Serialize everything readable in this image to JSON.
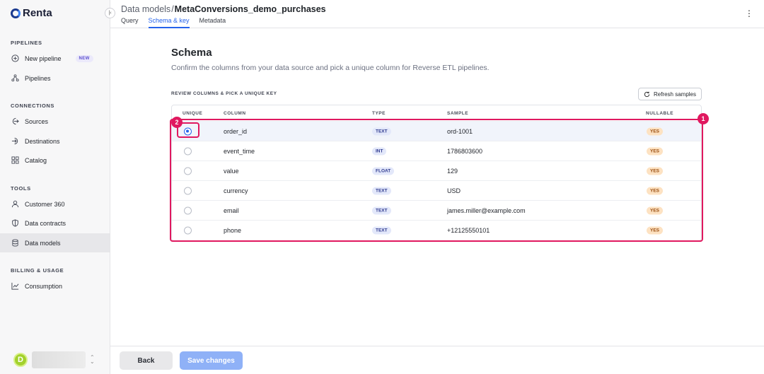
{
  "app": {
    "name": "Renta"
  },
  "sidebar": {
    "sections": [
      {
        "title": "PIPELINES"
      },
      {
        "title": "CONNECTIONS"
      },
      {
        "title": "TOOLS"
      },
      {
        "title": "BILLING & USAGE"
      }
    ],
    "items": [
      {
        "label": "New pipeline",
        "icon": "plus-circle-icon",
        "badge": "NEW"
      },
      {
        "label": "Pipelines",
        "icon": "nodes-icon"
      },
      {
        "label": "Sources",
        "icon": "source-icon"
      },
      {
        "label": "Destinations",
        "icon": "destination-icon"
      },
      {
        "label": "Catalog",
        "icon": "grid-icon"
      },
      {
        "label": "Customer 360",
        "icon": "user-icon"
      },
      {
        "label": "Data contracts",
        "icon": "shield-icon"
      },
      {
        "label": "Data models",
        "icon": "database-icon",
        "active": true
      },
      {
        "label": "Consumption",
        "icon": "chart-icon"
      }
    ],
    "user": {
      "initial": "D"
    }
  },
  "header": {
    "breadcrumb_parent": "Data models",
    "breadcrumb_sep": "/",
    "breadcrumb_current": "MetaConversions_demo_purchases",
    "tabs": [
      {
        "label": "Query"
      },
      {
        "label": "Schema & key",
        "active": true
      },
      {
        "label": "Metadata"
      }
    ]
  },
  "main": {
    "title": "Schema",
    "subtitle": "Confirm the columns from your data source and pick a unique column for Reverse ETL pipelines.",
    "review_label": "REVIEW COLUMNS & PICK A UNIQUE KEY",
    "refresh_label": "Refresh samples",
    "table": {
      "headers": {
        "unique": "UNIQUE",
        "column": "COLUMN",
        "type": "TYPE",
        "sample": "SAMPLE",
        "nullable": "NULLABLE"
      },
      "rows": [
        {
          "column": "order_id",
          "type": "TEXT",
          "sample": "ord-1001",
          "nullable": "YES",
          "selected": true
        },
        {
          "column": "event_time",
          "type": "INT",
          "sample": "1786803600",
          "nullable": "YES"
        },
        {
          "column": "value",
          "type": "FLOAT",
          "sample": "129",
          "nullable": "YES"
        },
        {
          "column": "currency",
          "type": "TEXT",
          "sample": "USD",
          "nullable": "YES"
        },
        {
          "column": "email",
          "type": "TEXT",
          "sample": "james.miller@example.com",
          "nullable": "YES"
        },
        {
          "column": "phone",
          "type": "TEXT",
          "sample": "+12125550101",
          "nullable": "YES"
        }
      ]
    },
    "markers": {
      "one": "1",
      "two": "2"
    }
  },
  "footer": {
    "back_label": "Back",
    "save_label": "Save changes"
  },
  "colors": {
    "accent": "#2563eb",
    "highlight": "#e0185f",
    "save_button": "#8fb1f7"
  }
}
